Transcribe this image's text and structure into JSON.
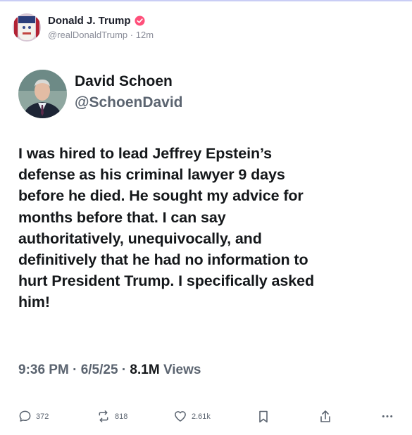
{
  "post": {
    "author_name": "Donald J. Trump",
    "handle": "@realDonaldTrump",
    "time_ago": "12m",
    "avatar": "user-avatar-icon",
    "verified_icon": "verified-badge-icon",
    "verified_color": "#ff4f7a"
  },
  "embedded_tweet": {
    "author_name": "David Schoen",
    "handle": "@SchoenDavid",
    "text": "I was hired to lead Jeffrey Epstein’s\ndefense as his criminal lawyer 9 days\nbefore he died.  He sought my advice for\nmonths before that.  I can say\nauthoritatively, unequivocally, and\ndefinitively that he had no information to\nhurt President Trump.  I specifically asked\nhim!",
    "time": "9:36 PM",
    "date": "6/5/25",
    "views_count": "8.1M",
    "views_label": "Views"
  },
  "actions": {
    "replies": "372",
    "retruths": "818",
    "likes": "2.61k",
    "icons": [
      "comment-icon",
      "retruth-icon",
      "heart-icon",
      "bookmark-icon",
      "share-icon",
      "more-icon"
    ]
  }
}
